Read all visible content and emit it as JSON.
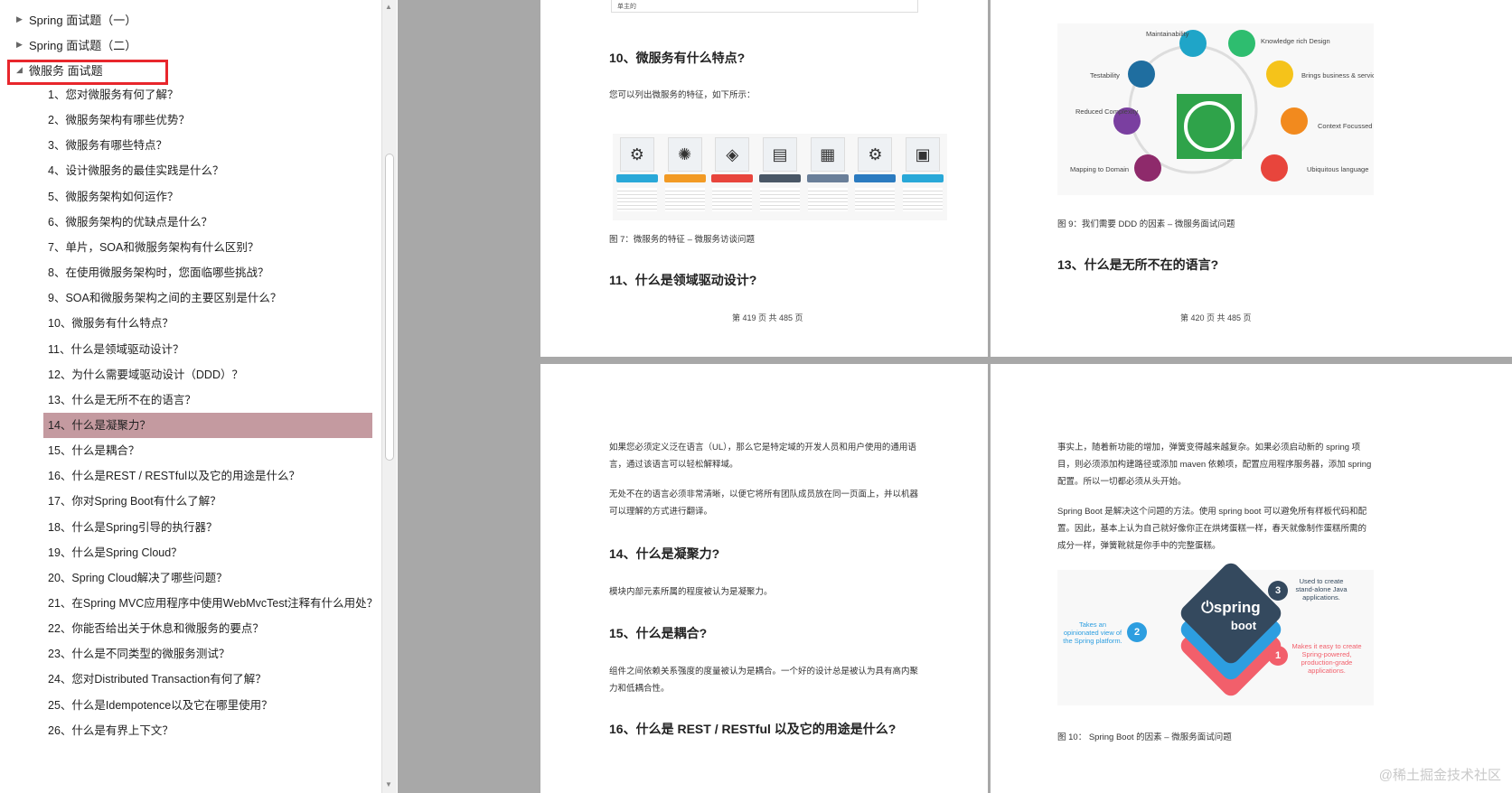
{
  "sidebar": {
    "top_items": [
      {
        "label": "Spring 面试题（一）"
      },
      {
        "label": "Spring 面试题（二）"
      },
      {
        "label": "微服务 面试题"
      }
    ],
    "items": [
      {
        "label": "1、您对微服务有何了解？"
      },
      {
        "label": "2、微服务架构有哪些优势？"
      },
      {
        "label": "3、微服务有哪些特点？"
      },
      {
        "label": "4、设计微服务的最佳实践是什么？"
      },
      {
        "label": "5、微服务架构如何运作？"
      },
      {
        "label": "6、微服务架构的优缺点是什么？"
      },
      {
        "label": "7、单片，SOA和微服务架构有什么区别？"
      },
      {
        "label": "8、在使用微服务架构时，您面临哪些挑战？"
      },
      {
        "label": "9、SOA和微服务架构之间的主要区别是什么？"
      },
      {
        "label": "10、微服务有什么特点？"
      },
      {
        "label": "11、什么是领域驱动设计？"
      },
      {
        "label": "12、为什么需要域驱动设计（DDD）？"
      },
      {
        "label": "13、什么是无所不在的语言？"
      },
      {
        "label": "14、什么是凝聚力？"
      },
      {
        "label": "15、什么是耦合？"
      },
      {
        "label": "16、什么是REST / RESTful以及它的用途是什么？"
      },
      {
        "label": "17、你对Spring Boot有什么了解？"
      },
      {
        "label": "18、什么是Spring引导的执行器？"
      },
      {
        "label": "19、什么是Spring Cloud？"
      },
      {
        "label": "20、Spring Cloud解决了哪些问题？"
      },
      {
        "label": "21、在Spring MVC应用程序中使用WebMvcTest注释有什么用处？"
      },
      {
        "label": "22、你能否给出关于休息和微服务的要点？"
      },
      {
        "label": "23、什么是不同类型的微服务测试？"
      },
      {
        "label": "24、您对Distributed Transaction有何了解？"
      },
      {
        "label": "25、什么是Idempotence以及它在哪里使用？"
      },
      {
        "label": "26、什么是有界上下文？"
      }
    ]
  },
  "pages": {
    "p1": {
      "table_cell": "单主的",
      "heading_10": "10、微服务有什么特点?",
      "intro": "您可以列出微服务的特征，如下所示：",
      "caption": "图 7：微服务的特征 – 微服务访谈问题",
      "heading_11": "11、什么是领域驱动设计?",
      "footer": "第 419 页 共 485 页"
    },
    "p2": {
      "ddd_labels": {
        "maintainability": "Maintainability",
        "knowledge": "Knowledge rich Design",
        "testability": "Testability",
        "brings": "Brings business & service together",
        "reduced": "Reduced Complexity",
        "context": "Context Focussed",
        "mapping": "Mapping to Domain",
        "ubiquitous": "Ubiquitous language"
      },
      "caption": "图 9：我们需要 DDD 的因素 – 微服务面试问题",
      "heading_13": "13、什么是无所不在的语言?",
      "footer": "第 420 页 共 485 页"
    },
    "p3": {
      "para1": "如果您必须定义泛在语言（UL），那么它是特定域的开发人员和用户使用的通用语言，通过该语言可以轻松解释域。",
      "para2": "无处不在的语言必须非常清晰，以便它将所有团队成员放在同一页面上，并以机器可以理解的方式进行翻译。",
      "heading_14": "14、什么是凝聚力?",
      "para3": "模块内部元素所属的程度被认为是凝聚力。",
      "heading_15": "15、什么是耦合?",
      "para4": "组件之间依赖关系强度的度量被认为是耦合。一个好的设计总是被认为具有高内聚力和低耦合性。",
      "heading_16": "16、什么是 REST / RESTful 以及它的用途是什么?"
    },
    "p4": {
      "para1": "事实上，随着新功能的增加，弹簧变得越来越复杂。如果必须启动新的 spring 项目，则必须添加构建路径或添加 maven 依赖项，配置应用程序服务器，添加 spring 配置。所以一切都必须从头开始。",
      "para2": "Spring Boot 是解决这个问题的方法。使用 spring boot 可以避免所有样板代码和配置。因此，基本上认为自己就好像你正在烘烤蛋糕一样，春天就像制作蛋糕所需的成分一样，弹簧靴就是你手中的完整蛋糕。",
      "spring_logo": "spring",
      "spring_logo2": "boot",
      "note1": "Makes it easy to create Spring-powered, production-grade applications.",
      "note2": "Takes an opinionated view of the Spring platform.",
      "note3": "Used to create stand-alone Java applications.",
      "badge1": "1",
      "badge2": "2",
      "badge3": "3",
      "caption": "图 10： Spring Boot 的因素 – 微服务面试问题"
    }
  },
  "watermark": "@稀土掘金技术社区",
  "colors": {
    "selected_bg": "#c49aa0",
    "highlight_border": "#e8262c",
    "viewer_bg": "#a8a8a8"
  }
}
